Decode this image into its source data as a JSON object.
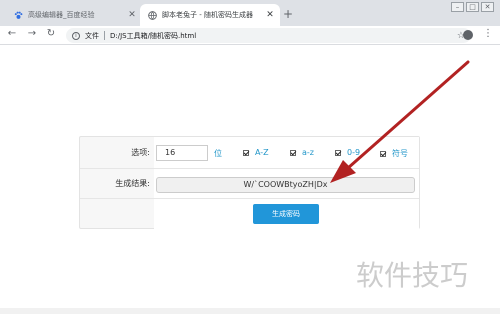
{
  "tabs": [
    {
      "title": "高级编辑器_百度经验",
      "favicon": "paw-favicon"
    },
    {
      "title": "脚本老兔子 - 随机密码生成器",
      "favicon": "globe-favicon"
    }
  ],
  "window_controls": {
    "minimize": "–",
    "maximize": "□",
    "close": "✕"
  },
  "toolbar": {
    "back": "←",
    "forward": "→",
    "reload": "↻",
    "address_prefix": "文件",
    "address": "D:/JS工具箱/随机密码.html",
    "star": "☆",
    "menu": "⋮"
  },
  "form": {
    "options_label": "选项:",
    "length_value": "16",
    "length_unit": "位",
    "options": [
      {
        "label": "A-Z",
        "checked": true
      },
      {
        "label": "a-z",
        "checked": true
      },
      {
        "label": "0-9",
        "checked": true
      },
      {
        "label": "符号",
        "checked": true
      }
    ],
    "result_label": "生成结果:",
    "result_value": "W/`COOWBtyoZH|Dx",
    "generate_button": "生成密码"
  },
  "annotation": {
    "arrow_color": "#b22222"
  },
  "watermark": "软件技巧",
  "colors": {
    "accent": "#2196d9",
    "link": "#2196c9",
    "arrow": "#b22222"
  }
}
